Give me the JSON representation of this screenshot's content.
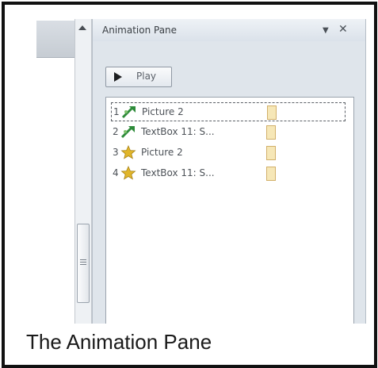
{
  "animation_pane": {
    "title": "Animation Pane",
    "dropdown_icon": "chevron-down-icon",
    "close_icon": "close-icon",
    "play_button": {
      "label": "Play",
      "icon": "play-icon"
    },
    "items": [
      {
        "number": "1",
        "label": "Picture 2",
        "effect_icon": "entrance-effect-icon",
        "selected": true
      },
      {
        "number": "2",
        "label": "TextBox 11: S...",
        "effect_icon": "entrance-effect-icon",
        "selected": false
      },
      {
        "number": "3",
        "label": "Picture 2",
        "effect_icon": "emphasis-effect-icon",
        "selected": false
      },
      {
        "number": "4",
        "label": "TextBox 11: S...",
        "effect_icon": "emphasis-effect-icon",
        "selected": false
      }
    ]
  },
  "caption": "The Animation Pane",
  "colors": {
    "entrance_effect": "#2e8b3a",
    "emphasis_effect": "#e0b52a",
    "timing_bar": "#f6e7b7",
    "frame_border": "#111111"
  }
}
